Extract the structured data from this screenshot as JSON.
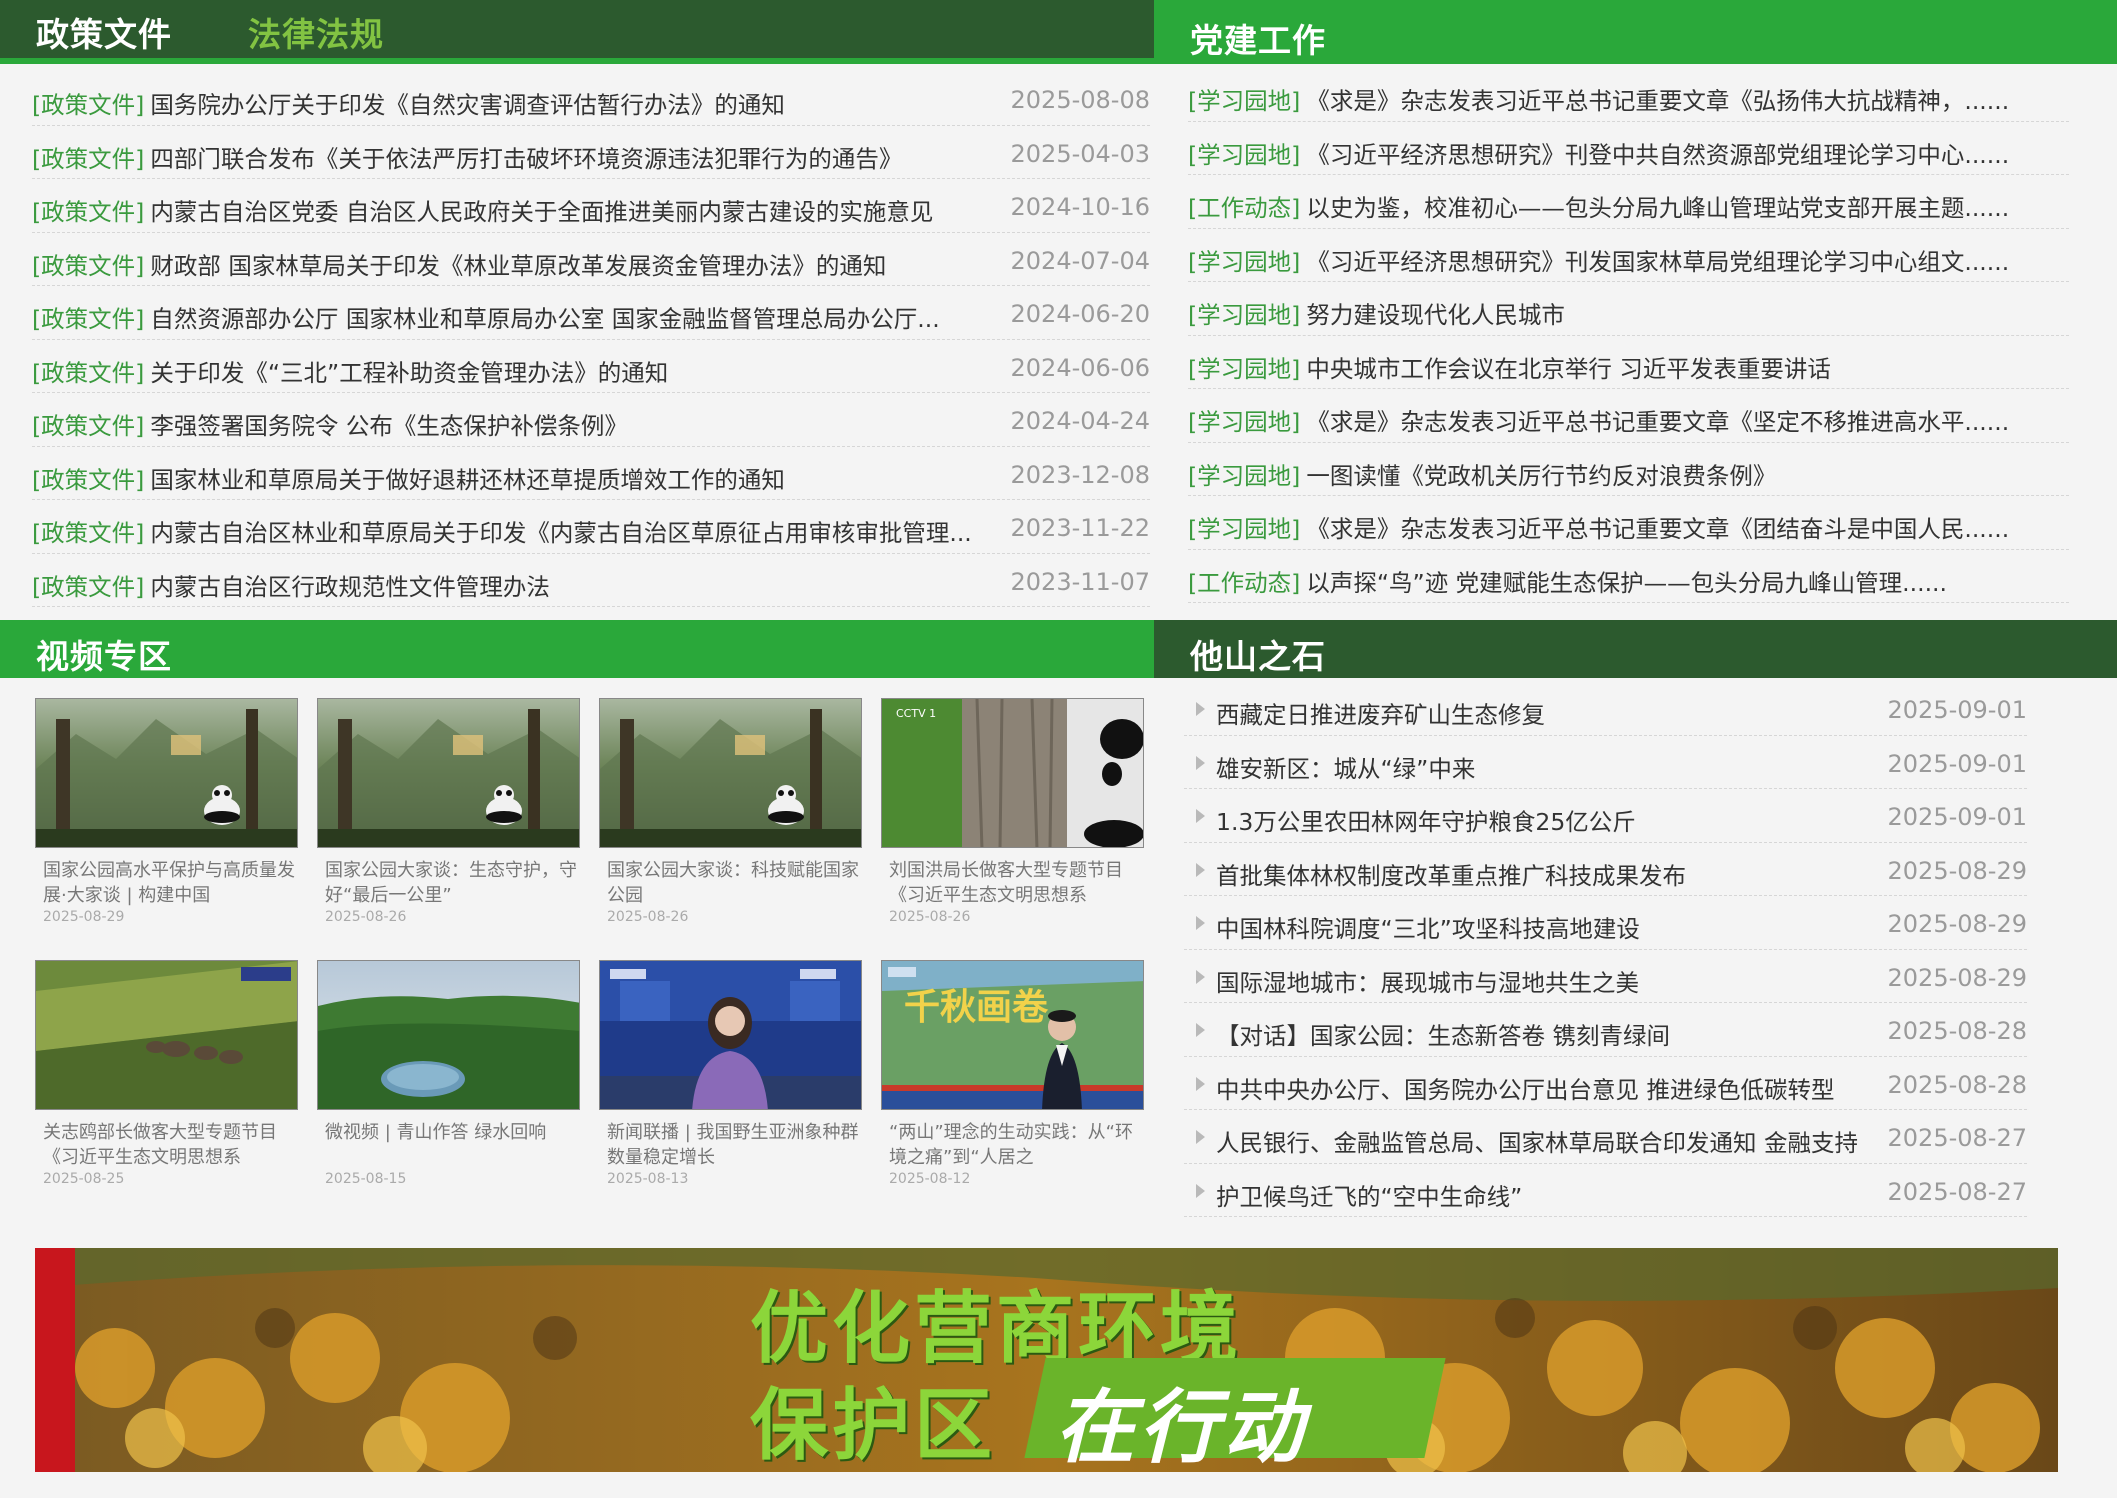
{
  "policy": {
    "tab_active": "政策文件",
    "tab_inactive": "法律法规",
    "items": [
      {
        "cat": "[政策文件]",
        "title": "国务院办公厅关于印发《自然灾害调查评估暂行办法》的通知",
        "date": "2025-08-08"
      },
      {
        "cat": "[政策文件]",
        "title": "四部门联合发布《关于依法严厉打击破坏环境资源违法犯罪行为的通告》",
        "date": "2025-04-03"
      },
      {
        "cat": "[政策文件]",
        "title": "内蒙古自治区党委 自治区人民政府关于全面推进美丽内蒙古建设的实施意见",
        "date": "2024-10-16"
      },
      {
        "cat": "[政策文件]",
        "title": "财政部 国家林草局关于印发《林业草原改革发展资金管理办法》的通知",
        "date": "2024-07-04"
      },
      {
        "cat": "[政策文件]",
        "title": "自然资源部办公厅 国家林业和草原局办公室 国家金融监督管理总局办公厅...",
        "date": "2024-06-20"
      },
      {
        "cat": "[政策文件]",
        "title": "关于印发《“三北”工程补助资金管理办法》的通知",
        "date": "2024-06-06"
      },
      {
        "cat": "[政策文件]",
        "title": "李强签署国务院令 公布《生态保护补偿条例》",
        "date": "2024-04-24"
      },
      {
        "cat": "[政策文件]",
        "title": "国家林业和草原局关于做好退耕还林还草提质增效工作的通知",
        "date": "2023-12-08"
      },
      {
        "cat": "[政策文件]",
        "title": "内蒙古自治区林业和草原局关于印发《内蒙古自治区草原征占用审核审批管理...",
        "date": "2023-11-22"
      },
      {
        "cat": "[政策文件]",
        "title": "内蒙古自治区行政规范性文件管理办法",
        "date": "2023-11-07"
      }
    ]
  },
  "party": {
    "title": "党建工作",
    "items": [
      {
        "cat": "[学习园地]",
        "title": "《求是》杂志发表习近平总书记重要文章《弘扬伟大抗战精神，......"
      },
      {
        "cat": "[学习园地]",
        "title": "《习近平经济思想研究》刊登中共自然资源部党组理论学习中心......"
      },
      {
        "cat": "[工作动态]",
        "title": "以史为鉴，校准初心——包头分局九峰山管理站党支部开展主题......"
      },
      {
        "cat": "[学习园地]",
        "title": "《习近平经济思想研究》刊发国家林草局党组理论学习中心组文......"
      },
      {
        "cat": "[学习园地]",
        "title": "努力建设现代化人民城市"
      },
      {
        "cat": "[学习园地]",
        "title": "中央城市工作会议在北京举行 习近平发表重要讲话"
      },
      {
        "cat": "[学习园地]",
        "title": "《求是》杂志发表习近平总书记重要文章《坚定不移推进高水平......"
      },
      {
        "cat": "[学习园地]",
        "title": "一图读懂《党政机关厉行节约反对浪费条例》"
      },
      {
        "cat": "[学习园地]",
        "title": "《求是》杂志发表习近平总书记重要文章《团结奋斗是中国人民......"
      },
      {
        "cat": "[工作动态]",
        "title": "以声探“鸟”迹 党建赋能生态保护——包头分局九峰山管理......"
      }
    ]
  },
  "video": {
    "title": "视频专区",
    "items": [
      {
        "caption": "国家公园高水平保护与高质量发展·大家谈 | 构建中国",
        "date": "2025-08-29"
      },
      {
        "caption": "国家公园大家谈：生态守护，守好“最后一公里”",
        "date": "2025-08-26"
      },
      {
        "caption": "国家公园大家谈：科技赋能国家公园",
        "date": "2025-08-26"
      },
      {
        "caption": "刘国洪局长做客大型专题节目《习近平生态文明思想系",
        "date": "2025-08-26"
      },
      {
        "caption": "关志鸥部长做客大型专题节目《习近平生态文明思想系",
        "date": "2025-08-25"
      },
      {
        "caption": "微视频 | 青山作答 绿水回响",
        "date": "2025-08-15"
      },
      {
        "caption": "新闻联播 | 我国野生亚洲象种群数量稳定增长",
        "date": "2025-08-13"
      },
      {
        "caption": "“两山”理念的生动实践：从“环境之痛”到“人居之",
        "date": "2025-08-12"
      }
    ],
    "overlay_texts": [
      "CCTV 1",
      "千秋画卷"
    ]
  },
  "others": {
    "title": "他山之石",
    "items": [
      {
        "title": "西藏定日推进废弃矿山生态修复",
        "date": "2025-09-01"
      },
      {
        "title": "雄安新区：城从“绿”中来",
        "date": "2025-09-01"
      },
      {
        "title": "1.3万公里农田林网年守护粮食25亿公斤",
        "date": "2025-09-01"
      },
      {
        "title": "首批集体林权制度改革重点推广科技成果发布",
        "date": "2025-08-29"
      },
      {
        "title": "中国林科院调度“三北”攻坚科技高地建设",
        "date": "2025-08-29"
      },
      {
        "title": "国际湿地城市：展现城市与湿地共生之美",
        "date": "2025-08-29"
      },
      {
        "title": "【对话】国家公园：生态新答卷 镌刻青绿间",
        "date": "2025-08-28"
      },
      {
        "title": "中共中央办公厅、国务院办公厅出台意见 推进绿色低碳转型",
        "date": "2025-08-28"
      },
      {
        "title": "人民银行、金融监管总局、国家林草局联合印发通知 金融支持",
        "date": "2025-08-27"
      },
      {
        "title": "护卫候鸟迁飞的“空中生命线”",
        "date": "2025-08-27"
      }
    ]
  },
  "banner": {
    "line1": "优化营商环境",
    "line2a": "保护区",
    "line2b": "在行动"
  },
  "colors": {
    "dark_green": "#2c5a2e",
    "bright_green": "#2aa83a",
    "category_green": "#3a9a3e",
    "light_green": "#82c342"
  }
}
